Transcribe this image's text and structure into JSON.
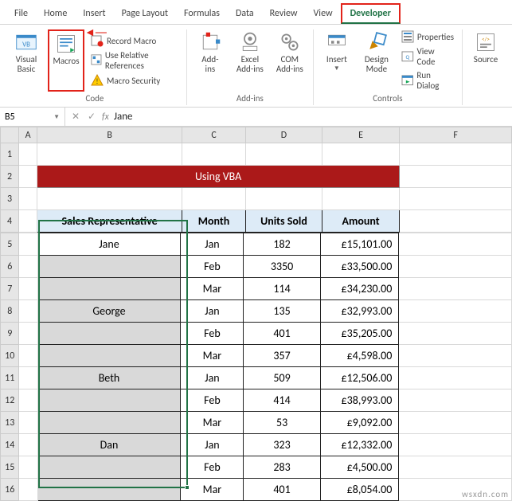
{
  "tabs": {
    "file": "File",
    "home": "Home",
    "insert": "Insert",
    "pagelayout": "Page Layout",
    "formulas": "Formulas",
    "data": "Data",
    "review": "Review",
    "view": "View",
    "developer": "Developer"
  },
  "ribbon": {
    "code": {
      "visual_basic": "Visual\nBasic",
      "macros": "Macros",
      "record_macro": "Record Macro",
      "use_relative": "Use Relative References",
      "macro_security": "Macro Security",
      "group": "Code"
    },
    "addins": {
      "addins": "Add-\nins",
      "excel_addins": "Excel\nAdd-ins",
      "com_addins": "COM\nAdd-ins",
      "group": "Add-ins"
    },
    "controls": {
      "insert": "Insert",
      "design_mode": "Design\nMode",
      "properties": "Properties",
      "view_code": "View Code",
      "run_dialog": "Run Dialog",
      "group": "Controls"
    },
    "xml": {
      "source": "Source"
    }
  },
  "namebox": {
    "ref": "B5",
    "formula": "Jane"
  },
  "columns": {
    "A": "A",
    "B": "B",
    "C": "C",
    "D": "D",
    "E": "E",
    "F": "F"
  },
  "title": "Using VBA",
  "headers": {
    "rep": "Sales Representative",
    "month": "Month",
    "units": "Units Sold",
    "amount": "Amount"
  },
  "chart_data": {
    "type": "table",
    "columns": [
      "Sales Representative",
      "Month",
      "Units Sold",
      "Amount"
    ],
    "rows": [
      {
        "rep": "Jane",
        "month": "Jan",
        "units": 182,
        "amount": "£15,101.00"
      },
      {
        "rep": "",
        "month": "Feb",
        "units": 3350,
        "amount": "£33,500.00"
      },
      {
        "rep": "",
        "month": "Mar",
        "units": 114,
        "amount": "£34,230.00"
      },
      {
        "rep": "George",
        "month": "Jan",
        "units": 135,
        "amount": "£32,993.00"
      },
      {
        "rep": "",
        "month": "Feb",
        "units": 401,
        "amount": "£35,205.00"
      },
      {
        "rep": "",
        "month": "Mar",
        "units": 357,
        "amount": "£4,598.00"
      },
      {
        "rep": "Beth",
        "month": "Jan",
        "units": 509,
        "amount": "£12,506.00"
      },
      {
        "rep": "",
        "month": "Feb",
        "units": 414,
        "amount": "£38,993.00"
      },
      {
        "rep": "",
        "month": "Mar",
        "units": 53,
        "amount": "£9,092.00"
      },
      {
        "rep": "Dan",
        "month": "Jan",
        "units": 323,
        "amount": "£12,332.00"
      },
      {
        "rep": "",
        "month": "Feb",
        "units": 283,
        "amount": "£4,500.00"
      },
      {
        "rep": "",
        "month": "Mar",
        "units": 401,
        "amount": "£8,054.00"
      }
    ]
  },
  "watermark": "wsxdn.com"
}
